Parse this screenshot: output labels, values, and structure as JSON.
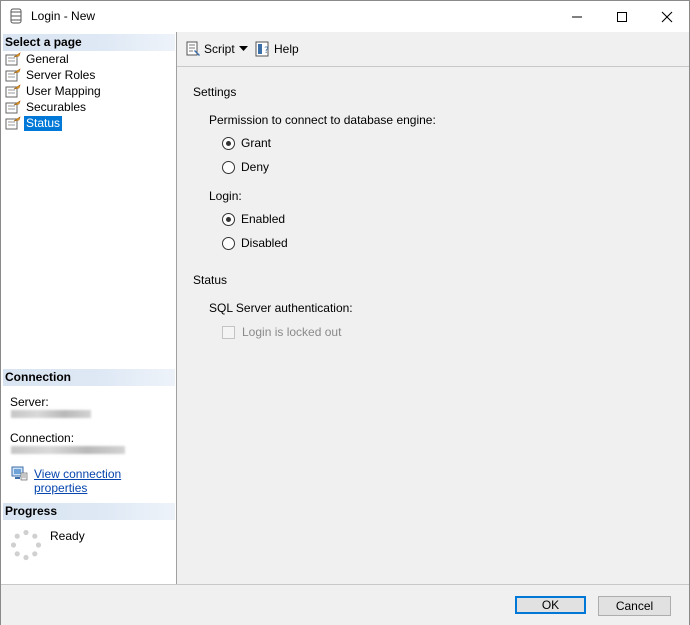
{
  "window": {
    "title": "Login - New"
  },
  "left": {
    "select_page_header": "Select a page",
    "pages": [
      {
        "label": "General"
      },
      {
        "label": "Server Roles"
      },
      {
        "label": "User Mapping"
      },
      {
        "label": "Securables"
      },
      {
        "label": "Status",
        "selected": true
      }
    ],
    "connection": {
      "header": "Connection",
      "server_label": "Server:",
      "connection_label": "Connection:",
      "view_link": "View connection properties"
    },
    "progress": {
      "header": "Progress",
      "status": "Ready"
    }
  },
  "toolbar": {
    "script_label": "Script",
    "help_label": "Help"
  },
  "content": {
    "settings_label": "Settings",
    "permission_label": "Permission to connect to database engine:",
    "grant_label": "Grant",
    "deny_label": "Deny",
    "permission_value": "Grant",
    "login_label": "Login:",
    "enabled_label": "Enabled",
    "disabled_label": "Disabled",
    "login_value": "Enabled",
    "status_label": "Status",
    "sql_auth_label": "SQL Server authentication:",
    "locked_out_label": "Login is locked out",
    "locked_out_checked": false
  },
  "buttons": {
    "ok_label": "OK",
    "cancel_label": "Cancel"
  },
  "colors": {
    "selection": "#0078d7",
    "link": "#0645ad"
  }
}
